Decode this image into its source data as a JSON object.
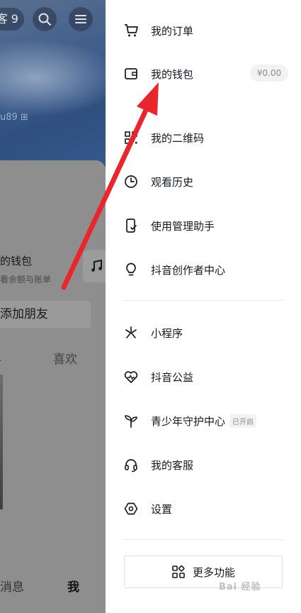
{
  "left_page": {
    "visitor_badge": "客 9",
    "user_id": "u89 ⊞",
    "wallet_title": "的钱包",
    "wallet_subtitle": "看余额与账单",
    "add_friend": "添加朋友",
    "tab_partial": "",
    "tab_likes": "喜欢",
    "nav_messages": "消息",
    "nav_me": "我"
  },
  "drawer": {
    "group1": [
      {
        "label": "我的订单",
        "icon": "cart-icon"
      },
      {
        "label": "我的钱包",
        "icon": "wallet-icon"
      },
      {
        "label": "我的二维码",
        "icon": "qr-code-icon"
      },
      {
        "label": "观看历史",
        "icon": "clock-icon"
      },
      {
        "label": "使用管理助手",
        "icon": "phone-check-icon"
      },
      {
        "label": "抖音创作者中心",
        "icon": "lightbulb-icon"
      }
    ],
    "wallet_balance": "¥0.00",
    "group2": [
      {
        "label": "小程序",
        "icon": "mini-program-icon"
      },
      {
        "label": "抖音公益",
        "icon": "heart-pulse-icon"
      },
      {
        "label": "青少年守护中心",
        "icon": "sprout-icon",
        "tag": "已开启"
      },
      {
        "label": "我的客服",
        "icon": "headset-icon"
      },
      {
        "label": "设置",
        "icon": "hexagon-settings-icon"
      }
    ],
    "more_button": "更多功能"
  },
  "watermark": "Bai 经验",
  "colors": {
    "arrow": "#e8262c",
    "text": "#161823",
    "muted": "#8a8b91",
    "overlay": "#8e8e8e"
  }
}
